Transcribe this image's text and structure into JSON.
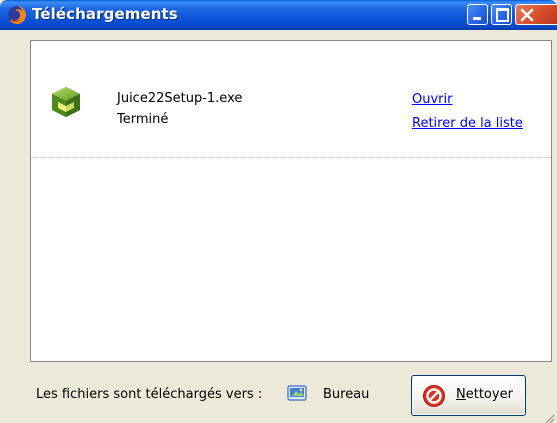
{
  "window": {
    "title": "Téléchargements",
    "icon": "firefox-icon"
  },
  "titlebar_buttons": {
    "minimize": "minimize-icon",
    "maximize": "maximize-icon",
    "close": "close-icon"
  },
  "downloads": [
    {
      "filename": "Juice22Setup-1.exe",
      "status": "Terminé",
      "icon": "installer-package-icon",
      "actions": {
        "open": "Ouvrir",
        "remove": "Retirer de la liste"
      }
    }
  ],
  "footer": {
    "destination_label": "Les fichiers sont téléchargés vers :",
    "folder_name": "Bureau",
    "folder_icon": "desktop-folder-icon",
    "clean_button": "Nettoyer",
    "clean_icon": "forbidden-icon"
  },
  "colors": {
    "titlebar": "#0a52d6",
    "link": "#0000ee",
    "close_button": "#d9512d",
    "window_bg": "#ece9d8"
  }
}
